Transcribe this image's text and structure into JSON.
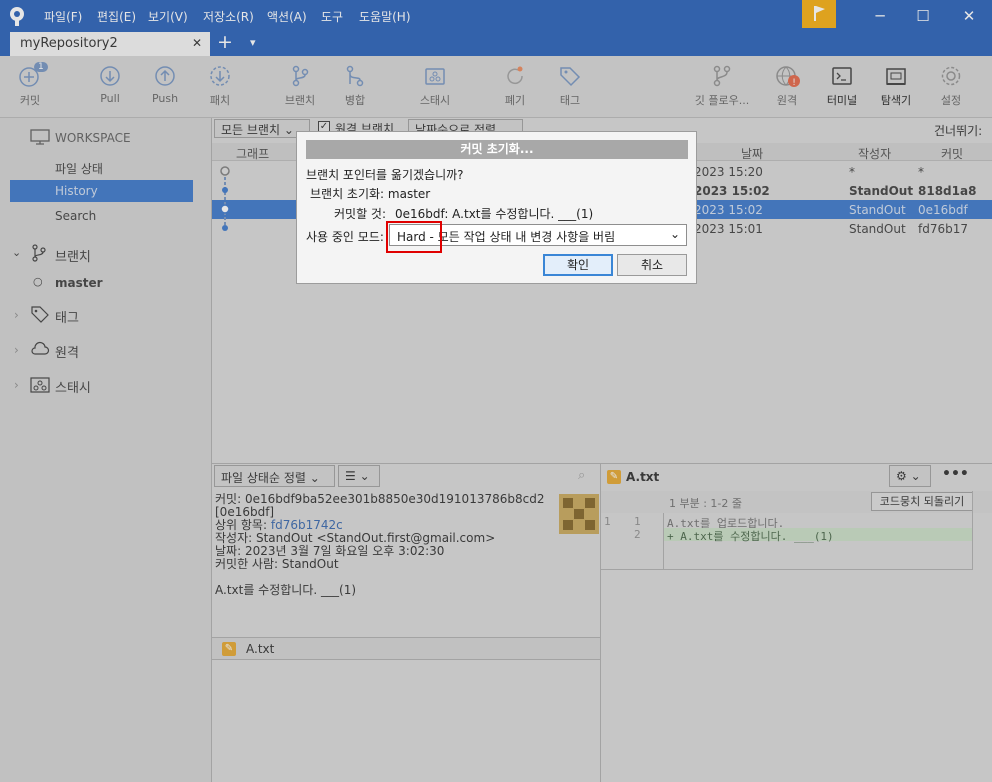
{
  "titlebar": {
    "menus": [
      "파일(F)",
      "편집(E)",
      "보기(V)",
      "저장소(R)",
      "액션(A)",
      "도구",
      "도움말(H)"
    ],
    "minimize": "─",
    "maximize": "☐",
    "close": "✕"
  },
  "tab": {
    "label": "myRepository2",
    "close": "✕",
    "add": "+",
    "dropdown": "▾"
  },
  "toolbar": {
    "commit": "커밋",
    "commit_badge": "1",
    "pull": "Pull",
    "push": "Push",
    "fetch": "패치",
    "branch": "브랜치",
    "merge": "병합",
    "stash": "스태시",
    "discard": "폐기",
    "tag": "태그",
    "git_flow": "깃 플로우...",
    "remote": "원격",
    "terminal": "터미널",
    "explorer": "탐색기",
    "settings": "설정"
  },
  "sidebar": {
    "workspace": "WORKSPACE",
    "file_status": "파일 상태",
    "history": "History",
    "search": "Search",
    "branches": "브랜치",
    "master": "master",
    "tags": "태그",
    "remotes": "원격",
    "stashes": "스태시"
  },
  "history": {
    "filter_all": "모든 브랜치",
    "remote_branches": "원격 브랜치",
    "sort": "날짜순으로 정렬",
    "skip": "건너뛰기:",
    "col_graph": "그래프",
    "col_date": "날짜",
    "col_author": "작성자",
    "col_commit": "커밋",
    "rows": [
      {
        "date": "2023 15:20",
        "author": "*",
        "commit": "*"
      },
      {
        "date": "2023 15:02",
        "author": "StandOut",
        "commit": "818d1a8"
      },
      {
        "date": "2023 15:02",
        "author": "StandOut",
        "commit": "0e16bdf"
      },
      {
        "date": "2023 15:01",
        "author": "StandOut",
        "commit": "fd76b17"
      }
    ]
  },
  "details": {
    "sort_by": "파일 상태순 정렬",
    "commit_line": "커밋: 0e16bdf9ba52ee301b8850e30d191013786b8cd2",
    "short_hash": "[0e16bdf]",
    "parent_label": "상위 항목:",
    "parent_hash": "fd76b1742c",
    "author": "작성자: StandOut <StandOut.first@gmail.com>",
    "date": "날짜: 2023년 3월 7일 화요일 오후 3:02:30",
    "committer": "커밋한 사람: StandOut",
    "message": "A.txt를 수정합니다. ___(1)",
    "file": "A.txt"
  },
  "diff": {
    "file": "A.txt",
    "hunk": "1 부분 : 1-2 줄",
    "revert": "코드뭉치 되돌리기",
    "lines": [
      {
        "old": "1",
        "new": "1",
        "text": "  A.txt를 업로드합니다."
      },
      {
        "old": "",
        "new": "2",
        "text": "+ A.txt를 수정합니다. ___(1)"
      }
    ]
  },
  "dialog": {
    "title": "커밋 초기화...",
    "question": "브랜치 포인터를 옮기겠습니까?",
    "branch_reset": "브랜치 초기화: master",
    "commit_to": "커밋할 것:",
    "commit_value": "0e16bdf: A.txt를 수정합니다. ___(1)",
    "mode_label": "사용 중인 모드:",
    "mode_value": "Hard - 모든 작업 상태 내 변경 사항을 버림",
    "ok": "확인",
    "cancel": "취소"
  },
  "colors": {
    "titlebar": "#1a56b4",
    "selection": "#2f6fc7",
    "accent_flag": "#f5a800",
    "highlight": "#e00000"
  }
}
